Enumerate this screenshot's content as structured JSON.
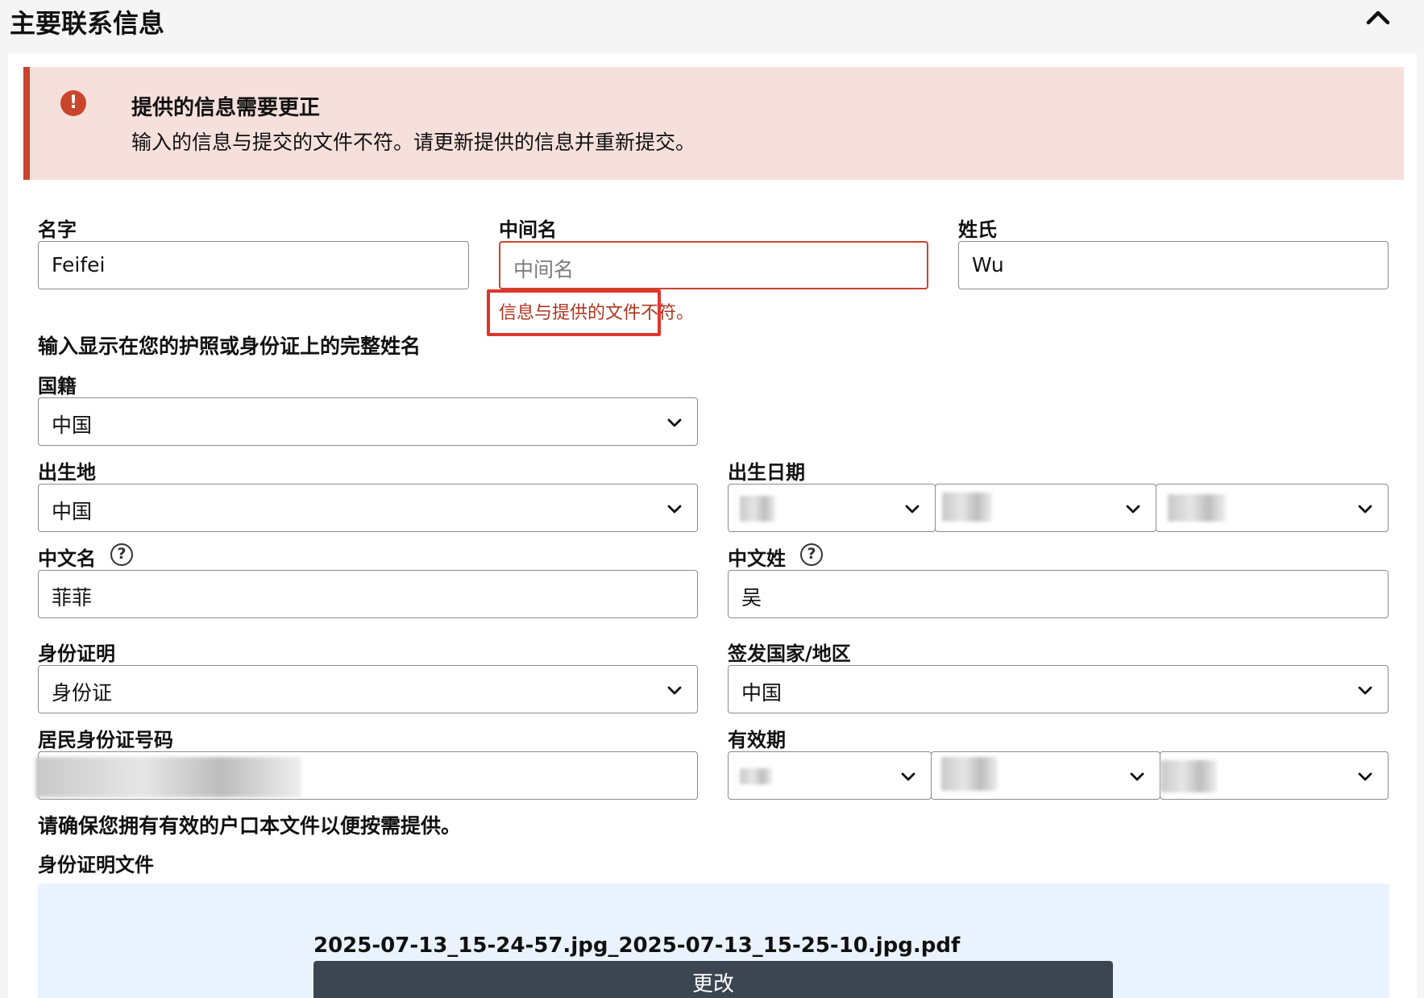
{
  "section": {
    "title": "主要联系信息",
    "collapse_icon": "chevron-up-icon"
  },
  "alert": {
    "icon": "exclamation-icon",
    "icon_glyph": "!",
    "title": "提供的信息需要更正",
    "message": "输入的信息与提交的文件不符。请更新提供的信息并重新提交。",
    "color": "#c9452b"
  },
  "name": {
    "first_label": "名字",
    "first_value": "Feifei",
    "middle_label": "中间名",
    "middle_placeholder": "中间名",
    "middle_error": "信息与提供的文件不符。",
    "last_label": "姓氏",
    "last_value": "Wu",
    "hint": "输入显示在您的护照或身份证上的完整姓名"
  },
  "nationality": {
    "label": "国籍",
    "value": "中国"
  },
  "birthplace": {
    "label": "出生地",
    "value": "中国"
  },
  "birthdate": {
    "label": "出生日期"
  },
  "chinese_name": {
    "first_label": "中文名",
    "first_value": "菲菲",
    "last_label": "中文姓",
    "last_value": "吴",
    "help_glyph": "?"
  },
  "id_document": {
    "label": "身份证明",
    "value": "身份证",
    "country_label": "签发国家/地区",
    "country_value": "中国",
    "number_label": "居民身份证号码",
    "expiry_label": "有效期"
  },
  "household": {
    "hint": "请确保您拥有有效的户口本文件以便按需提供。"
  },
  "upload": {
    "label": "身份证明文件",
    "file_name": "2025-07-13_15-24-57.jpg_2025-07-13_15-25-10.jpg.pdf",
    "change_label": "更改"
  },
  "colors": {
    "error": "#c9452b",
    "alert_bg": "#f6e0dc",
    "highlight": "#e0352a",
    "button_bg": "#3d4550",
    "upload_bg": "#eaf3fd"
  }
}
